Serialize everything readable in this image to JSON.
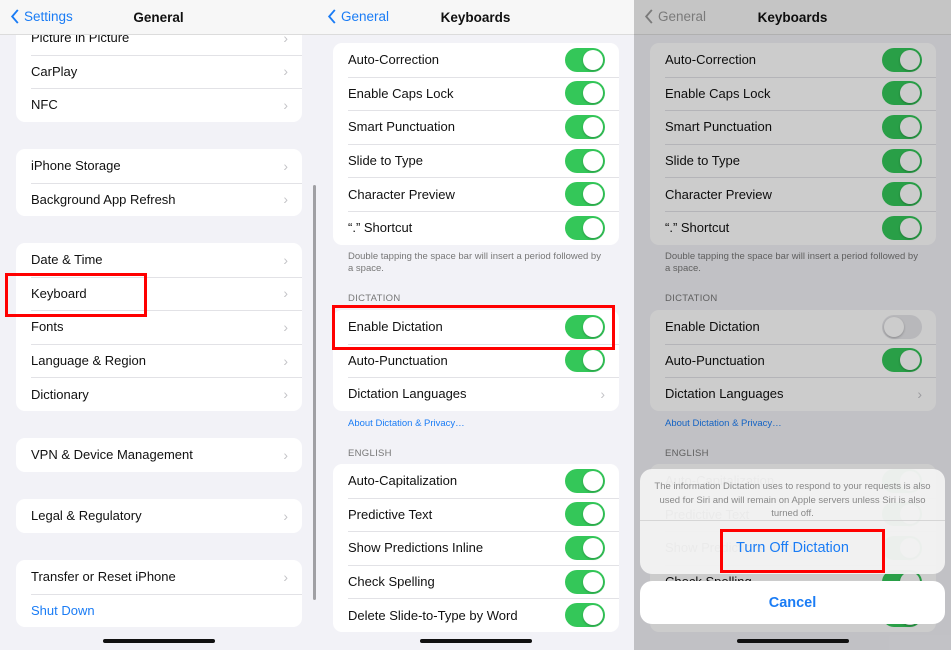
{
  "colors": {
    "accent": "#1a7cf5",
    "toggle_on": "#34c759",
    "highlight": "#ff0000"
  },
  "panel1": {
    "back": "Settings",
    "title": "General",
    "groups": [
      {
        "rows": [
          {
            "label": "Picture in Picture"
          },
          {
            "label": "CarPlay"
          },
          {
            "label": "NFC"
          }
        ]
      },
      {
        "rows": [
          {
            "label": "iPhone Storage"
          },
          {
            "label": "Background App Refresh"
          }
        ]
      },
      {
        "rows": [
          {
            "label": "Date & Time"
          },
          {
            "label": "Keyboard"
          },
          {
            "label": "Fonts"
          },
          {
            "label": "Language & Region"
          },
          {
            "label": "Dictionary"
          }
        ]
      },
      {
        "rows": [
          {
            "label": "VPN & Device Management"
          }
        ]
      },
      {
        "rows": [
          {
            "label": "Legal & Regulatory"
          }
        ]
      },
      {
        "rows": [
          {
            "label": "Transfer or Reset iPhone"
          },
          {
            "label": "Shut Down",
            "link": true,
            "nochev": true
          }
        ]
      }
    ]
  },
  "panel2": {
    "back": "General",
    "title": "Keyboards",
    "groups": [
      {
        "rows": [
          {
            "label": "Auto-Correction",
            "toggle": true
          },
          {
            "label": "Enable Caps Lock",
            "toggle": true
          },
          {
            "label": "Smart Punctuation",
            "toggle": true
          },
          {
            "label": "Slide to Type",
            "toggle": true
          },
          {
            "label": "Character Preview",
            "toggle": true
          },
          {
            "label": "“.” Shortcut",
            "toggle": true
          }
        ]
      },
      {
        "rows": [
          {
            "label": "Enable Dictation",
            "toggle": true
          },
          {
            "label": "Auto-Punctuation",
            "toggle": true
          },
          {
            "label": "Dictation Languages"
          }
        ]
      },
      {
        "rows": [
          {
            "label": "Auto-Capitalization",
            "toggle": true
          },
          {
            "label": "Predictive Text",
            "toggle": true
          },
          {
            "label": "Show Predictions Inline",
            "toggle": true
          },
          {
            "label": "Check Spelling",
            "toggle": true
          },
          {
            "label": "Delete Slide-to-Type by Word",
            "toggle": true
          }
        ]
      }
    ],
    "footer": "Double tapping the space bar will insert a period followed by a space.",
    "dictation_header": "DICTATION",
    "about_link": "About Dictation & Privacy…",
    "english_header": "ENGLISH"
  },
  "panel3": {
    "back": "General",
    "title": "Keyboards",
    "groups": [
      {
        "rows": [
          {
            "label": "Auto-Correction",
            "toggle": true
          },
          {
            "label": "Enable Caps Lock",
            "toggle": true
          },
          {
            "label": "Smart Punctuation",
            "toggle": true
          },
          {
            "label": "Slide to Type",
            "toggle": true
          },
          {
            "label": "Character Preview",
            "toggle": true
          },
          {
            "label": "“.” Shortcut",
            "toggle": true
          }
        ]
      },
      {
        "rows": [
          {
            "label": "Enable Dictation",
            "toggle": true,
            "off": true
          },
          {
            "label": "Auto-Punctuation",
            "toggle": true
          },
          {
            "label": "Dictation Languages"
          }
        ]
      },
      {
        "rows": [
          {
            "label": "Auto-Capitalization",
            "toggle": true
          },
          {
            "label": "Predictive Text",
            "toggle": true
          },
          {
            "label": "Show Predictions Inline",
            "toggle": true
          },
          {
            "label": "Check Spelling",
            "toggle": true
          },
          {
            "label": "Delete Slide-to-Type by Word",
            "toggle": true
          }
        ]
      }
    ],
    "footer": "Double tapping the space bar will insert a period followed by a space.",
    "dictation_header": "DICTATION",
    "about_link": "About Dictation & Privacy…",
    "english_header": "ENGLISH",
    "sheet": {
      "message": "The information Dictation uses to respond to your requests is also used for Siri and will remain on Apple servers unless Siri is also turned off.",
      "action": "Turn Off Dictation",
      "cancel": "Cancel"
    }
  }
}
